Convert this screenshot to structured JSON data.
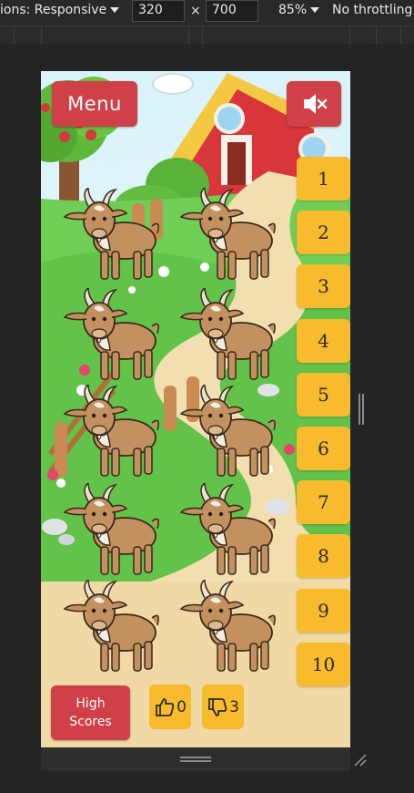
{
  "devtools": {
    "dimensions_label": "ions: Responsive",
    "width_value": "320",
    "times": "×",
    "height_value": "700",
    "zoom": "85%",
    "throttling": "No throttling"
  },
  "game": {
    "menu_label": "Menu",
    "mute_icon": "speaker-muted-icon",
    "level_buttons": [
      "1",
      "2",
      "3",
      "4",
      "5",
      "6",
      "7",
      "8",
      "9",
      "10"
    ],
    "goat_count": 10,
    "high_scores_label": [
      "High",
      "Scores"
    ],
    "thumbs_up_count": "0",
    "thumbs_down_count": "3",
    "colors": {
      "red_button": "#cf4048",
      "yellow_button": "#f7bb2d",
      "grass": "#6fcf55",
      "path": "#f2dfb0"
    }
  }
}
